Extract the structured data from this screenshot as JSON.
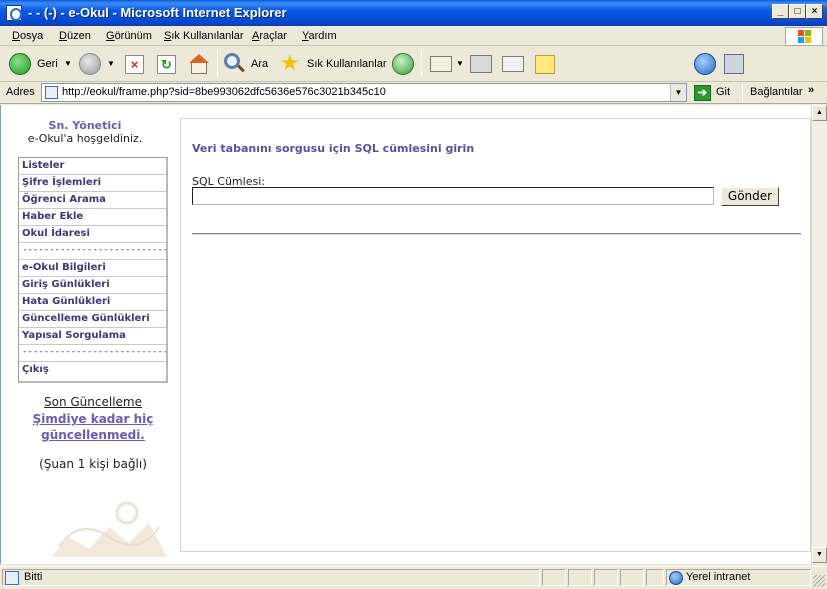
{
  "window": {
    "title": " - - (-) - e-Okul  - Microsoft Internet Explorer"
  },
  "menu": [
    "Dosya",
    "Düzen",
    "Görünüm",
    "Sık Kullanılanlar",
    "Araçlar",
    "Yardım"
  ],
  "toolbar": {
    "back_label": "Geri",
    "search_label": "Ara",
    "favorites_label": "Sık Kullanılanlar"
  },
  "address": {
    "label": "Adres",
    "url": "http://eokul/frame.php?sid=8be993062dfc5636e576c3021b345c10",
    "go_label": "Git",
    "links_label": "Bağlantılar"
  },
  "sidebar": {
    "greeting_title": "Sn. Yönetici",
    "greeting_text": "e-Okul'a hoşgeldiniz.",
    "items": [
      {
        "label": "Listeler"
      },
      {
        "label": "Şifre İşlemleri"
      },
      {
        "label": "Öğrenci Arama"
      },
      {
        "label": "Haber Ekle"
      },
      {
        "label": "Okul İdaresi"
      },
      {
        "label": "-----------------------------"
      },
      {
        "label": "e-Okul Bilgileri"
      },
      {
        "label": "Giriş Günlükleri"
      },
      {
        "label": "Hata Günlükleri"
      },
      {
        "label": "Güncelleme Günlükleri"
      },
      {
        "label": "Yapısal Sorgulama"
      },
      {
        "label": "-----------------------------"
      },
      {
        "label": "Çıkış"
      }
    ],
    "update_title": "Son Güncelleme",
    "update_link": "Şimdiye kadar hiç güncellenmedi.",
    "online_text": "(Şuan 1 kişi bağlı)"
  },
  "main": {
    "heading": "Veri tabanını sorgusu için SQL cümlesini girin",
    "field_label": "SQL Cümlesi:",
    "field_value": "",
    "submit_label": "Gönder"
  },
  "status": {
    "text": "Bitti",
    "zone": "Yerel intranet"
  }
}
